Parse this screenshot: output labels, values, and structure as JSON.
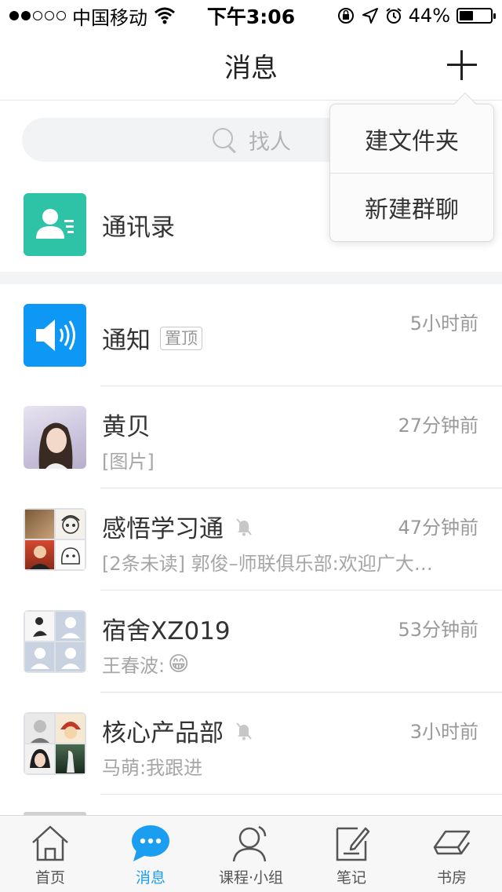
{
  "status_bar": {
    "carrier": "中国移动",
    "time": "下午3:06",
    "battery": "44%",
    "battery_level": 0.44
  },
  "header": {
    "title": "消息",
    "add_icon": "plus-icon"
  },
  "search": {
    "placeholder": "找人"
  },
  "contacts": {
    "label": "通讯录",
    "icon": "contact-card-icon"
  },
  "popup_menu": {
    "items": [
      {
        "label": "建文件夹"
      },
      {
        "label": "新建群聊"
      }
    ]
  },
  "messages": [
    {
      "name": "通知",
      "badge": "置顶",
      "time": "5小时前",
      "preview": "",
      "avatar": "speaker-icon"
    },
    {
      "name": "黄贝",
      "time": "27分钟前",
      "preview": "[图片]",
      "avatar": "photo-avatar"
    },
    {
      "name": "感悟学习通",
      "muted": true,
      "time": "47分钟前",
      "preview": "[2条未读] 郭俊–师联俱乐部:欢迎广大…",
      "avatar": "group-avatar"
    },
    {
      "name": "宿舍XZ019",
      "time": "53分钟前",
      "preview": "王春波:",
      "preview_emoji": "😁",
      "avatar": "group-avatar"
    },
    {
      "name": "核心产品部",
      "muted": true,
      "time": "3小时前",
      "preview": "马萌:我跟进",
      "avatar": "group-avatar"
    }
  ],
  "tabs": [
    {
      "label": "首页",
      "icon": "home-icon",
      "active": false
    },
    {
      "label": "消息",
      "icon": "chat-bubble-icon",
      "active": true
    },
    {
      "label": "课程·小组",
      "icon": "person-icon",
      "active": false
    },
    {
      "label": "笔记",
      "icon": "note-icon",
      "active": false
    },
    {
      "label": "书房",
      "icon": "book-icon",
      "active": false
    }
  ],
  "colors": {
    "accent": "#1c9ef0",
    "contacts_green": "#2ec3a6",
    "notice_blue": "#0d98f5"
  }
}
